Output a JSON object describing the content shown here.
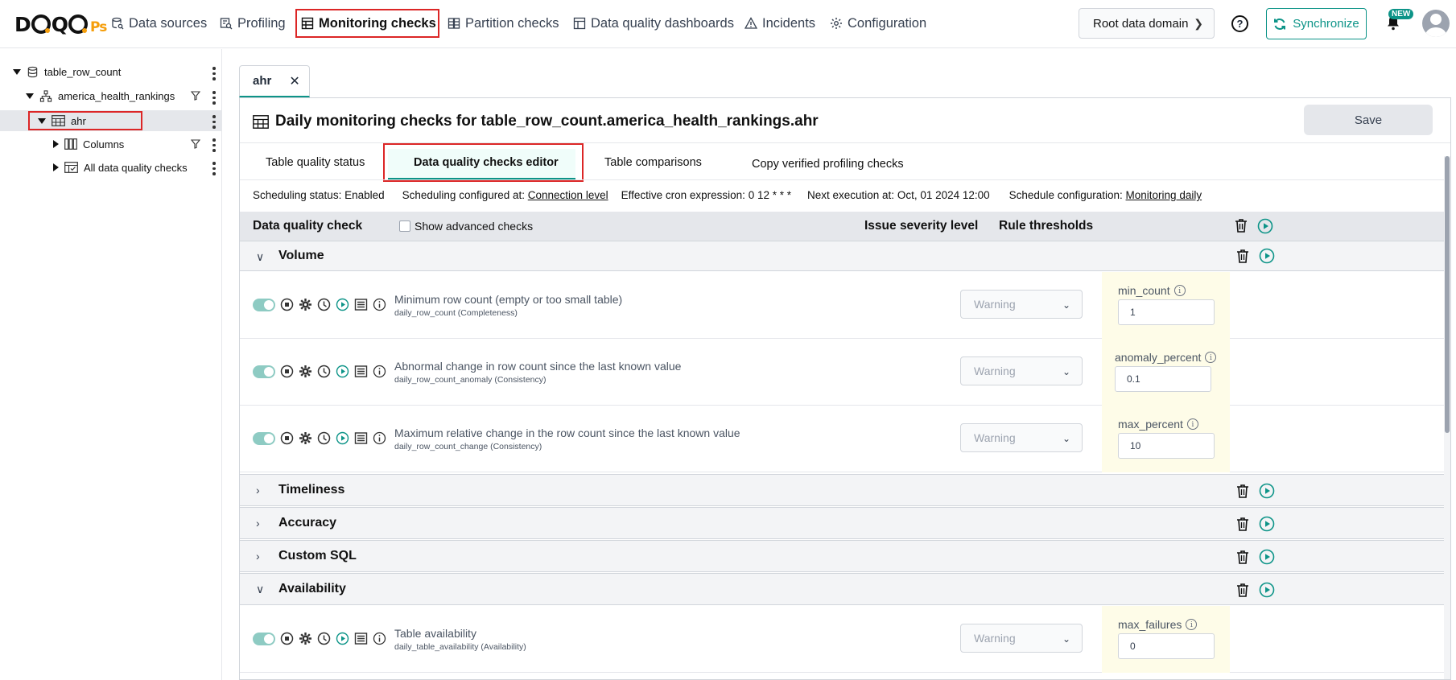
{
  "nav": {
    "logo_prefix": "D",
    "logo_suffix": "Ps",
    "items": [
      {
        "label": "Data sources",
        "icon": "database-search-icon"
      },
      {
        "label": "Profiling",
        "icon": "profiling-icon"
      },
      {
        "label": "Monitoring checks",
        "icon": "table-icon"
      },
      {
        "label": "Partition checks",
        "icon": "partition-icon"
      },
      {
        "label": "Data quality dashboards",
        "icon": "dashboard-icon"
      },
      {
        "label": "Incidents",
        "icon": "warning-icon"
      },
      {
        "label": "Configuration",
        "icon": "gear-icon"
      }
    ],
    "active": "Monitoring checks",
    "root_domain": "Root data domain",
    "synchronize": "Synchronize",
    "new_badge": "NEW"
  },
  "sidebar": {
    "items": [
      {
        "label": "table_row_count",
        "icon": "database-icon"
      },
      {
        "label": "america_health_rankings",
        "icon": "schema-icon"
      },
      {
        "label": "ahr",
        "icon": "table-icon"
      },
      {
        "label": "Columns",
        "icon": "columns-icon"
      },
      {
        "label": "All data quality checks",
        "icon": "checks-table-icon"
      }
    ]
  },
  "tab": {
    "label": "ahr"
  },
  "panel": {
    "title": "Daily monitoring checks for table_row_count.america_health_rankings.ahr",
    "save": "Save",
    "subtabs": [
      "Table quality status",
      "Data quality checks editor",
      "Table comparisons",
      "Copy verified profiling checks"
    ],
    "active_subtab": "Data quality checks editor"
  },
  "schedule": {
    "status_label": "Scheduling status:",
    "status_value": "Enabled",
    "configured_label": "Scheduling configured at:",
    "configured_value": "Connection level",
    "cron_label": "Effective cron expression:",
    "cron_value": "0 12 * * *",
    "next_label": "Next execution at:",
    "next_value": "Oct, 01 2024 12:00",
    "config_label": "Schedule configuration:",
    "config_value": "Monitoring daily"
  },
  "table_header": {
    "check": "Data quality check",
    "show_advanced": "Show advanced checks",
    "severity": "Issue severity level",
    "thresholds": "Rule thresholds"
  },
  "categories": {
    "volume": "Volume",
    "timeliness": "Timeliness",
    "accuracy": "Accuracy",
    "custom_sql": "Custom SQL",
    "availability": "Availability"
  },
  "checks": [
    {
      "name": "Minimum row count (empty or too small table)",
      "sub": "daily_row_count (Completeness)",
      "severity": "Warning",
      "param": "min_count",
      "value": "1"
    },
    {
      "name": "Abnormal change in row count since the last known value",
      "sub": "daily_row_count_anomaly (Consistency)",
      "severity": "Warning",
      "param": "anomaly_percent",
      "value": "0.1"
    },
    {
      "name": "Maximum relative change in the row count since the last known value",
      "sub": "daily_row_count_change (Consistency)",
      "severity": "Warning",
      "param": "max_percent",
      "value": "10"
    },
    {
      "name": "Table availability",
      "sub": "daily_table_availability (Availability)",
      "severity": "Warning",
      "param": "max_failures",
      "value": "0"
    }
  ],
  "colors": {
    "accent": "#0d9488",
    "highlight": "#dc2626",
    "rule_bg": "#fefce8"
  }
}
